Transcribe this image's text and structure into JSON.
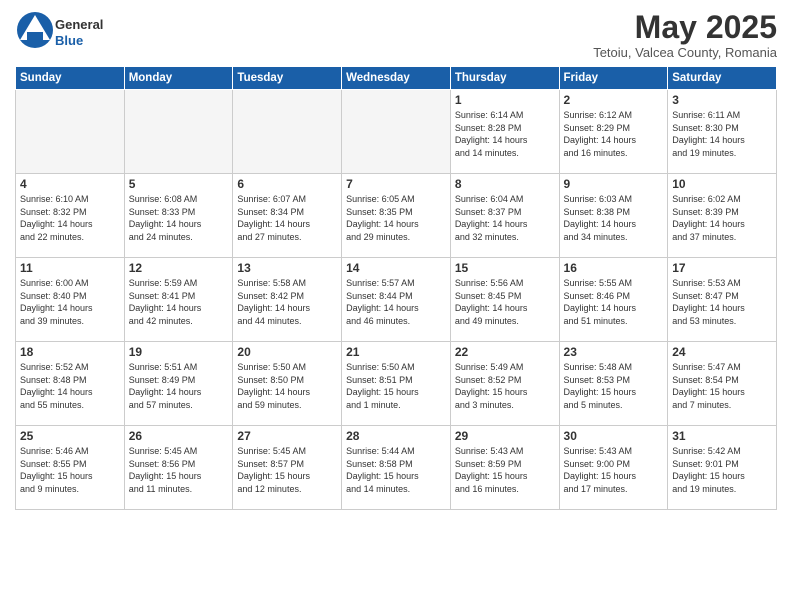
{
  "logo": {
    "general": "General",
    "blue": "Blue"
  },
  "title": "May 2025",
  "location": "Tetoiu, Valcea County, Romania",
  "headers": [
    "Sunday",
    "Monday",
    "Tuesday",
    "Wednesday",
    "Thursday",
    "Friday",
    "Saturday"
  ],
  "weeks": [
    [
      {
        "day": "",
        "info": ""
      },
      {
        "day": "",
        "info": ""
      },
      {
        "day": "",
        "info": ""
      },
      {
        "day": "",
        "info": ""
      },
      {
        "day": "1",
        "info": "Sunrise: 6:14 AM\nSunset: 8:28 PM\nDaylight: 14 hours\nand 14 minutes."
      },
      {
        "day": "2",
        "info": "Sunrise: 6:12 AM\nSunset: 8:29 PM\nDaylight: 14 hours\nand 16 minutes."
      },
      {
        "day": "3",
        "info": "Sunrise: 6:11 AM\nSunset: 8:30 PM\nDaylight: 14 hours\nand 19 minutes."
      }
    ],
    [
      {
        "day": "4",
        "info": "Sunrise: 6:10 AM\nSunset: 8:32 PM\nDaylight: 14 hours\nand 22 minutes."
      },
      {
        "day": "5",
        "info": "Sunrise: 6:08 AM\nSunset: 8:33 PM\nDaylight: 14 hours\nand 24 minutes."
      },
      {
        "day": "6",
        "info": "Sunrise: 6:07 AM\nSunset: 8:34 PM\nDaylight: 14 hours\nand 27 minutes."
      },
      {
        "day": "7",
        "info": "Sunrise: 6:05 AM\nSunset: 8:35 PM\nDaylight: 14 hours\nand 29 minutes."
      },
      {
        "day": "8",
        "info": "Sunrise: 6:04 AM\nSunset: 8:37 PM\nDaylight: 14 hours\nand 32 minutes."
      },
      {
        "day": "9",
        "info": "Sunrise: 6:03 AM\nSunset: 8:38 PM\nDaylight: 14 hours\nand 34 minutes."
      },
      {
        "day": "10",
        "info": "Sunrise: 6:02 AM\nSunset: 8:39 PM\nDaylight: 14 hours\nand 37 minutes."
      }
    ],
    [
      {
        "day": "11",
        "info": "Sunrise: 6:00 AM\nSunset: 8:40 PM\nDaylight: 14 hours\nand 39 minutes."
      },
      {
        "day": "12",
        "info": "Sunrise: 5:59 AM\nSunset: 8:41 PM\nDaylight: 14 hours\nand 42 minutes."
      },
      {
        "day": "13",
        "info": "Sunrise: 5:58 AM\nSunset: 8:42 PM\nDaylight: 14 hours\nand 44 minutes."
      },
      {
        "day": "14",
        "info": "Sunrise: 5:57 AM\nSunset: 8:44 PM\nDaylight: 14 hours\nand 46 minutes."
      },
      {
        "day": "15",
        "info": "Sunrise: 5:56 AM\nSunset: 8:45 PM\nDaylight: 14 hours\nand 49 minutes."
      },
      {
        "day": "16",
        "info": "Sunrise: 5:55 AM\nSunset: 8:46 PM\nDaylight: 14 hours\nand 51 minutes."
      },
      {
        "day": "17",
        "info": "Sunrise: 5:53 AM\nSunset: 8:47 PM\nDaylight: 14 hours\nand 53 minutes."
      }
    ],
    [
      {
        "day": "18",
        "info": "Sunrise: 5:52 AM\nSunset: 8:48 PM\nDaylight: 14 hours\nand 55 minutes."
      },
      {
        "day": "19",
        "info": "Sunrise: 5:51 AM\nSunset: 8:49 PM\nDaylight: 14 hours\nand 57 minutes."
      },
      {
        "day": "20",
        "info": "Sunrise: 5:50 AM\nSunset: 8:50 PM\nDaylight: 14 hours\nand 59 minutes."
      },
      {
        "day": "21",
        "info": "Sunrise: 5:50 AM\nSunset: 8:51 PM\nDaylight: 15 hours\nand 1 minute."
      },
      {
        "day": "22",
        "info": "Sunrise: 5:49 AM\nSunset: 8:52 PM\nDaylight: 15 hours\nand 3 minutes."
      },
      {
        "day": "23",
        "info": "Sunrise: 5:48 AM\nSunset: 8:53 PM\nDaylight: 15 hours\nand 5 minutes."
      },
      {
        "day": "24",
        "info": "Sunrise: 5:47 AM\nSunset: 8:54 PM\nDaylight: 15 hours\nand 7 minutes."
      }
    ],
    [
      {
        "day": "25",
        "info": "Sunrise: 5:46 AM\nSunset: 8:55 PM\nDaylight: 15 hours\nand 9 minutes."
      },
      {
        "day": "26",
        "info": "Sunrise: 5:45 AM\nSunset: 8:56 PM\nDaylight: 15 hours\nand 11 minutes."
      },
      {
        "day": "27",
        "info": "Sunrise: 5:45 AM\nSunset: 8:57 PM\nDaylight: 15 hours\nand 12 minutes."
      },
      {
        "day": "28",
        "info": "Sunrise: 5:44 AM\nSunset: 8:58 PM\nDaylight: 15 hours\nand 14 minutes."
      },
      {
        "day": "29",
        "info": "Sunrise: 5:43 AM\nSunset: 8:59 PM\nDaylight: 15 hours\nand 16 minutes."
      },
      {
        "day": "30",
        "info": "Sunrise: 5:43 AM\nSunset: 9:00 PM\nDaylight: 15 hours\nand 17 minutes."
      },
      {
        "day": "31",
        "info": "Sunrise: 5:42 AM\nSunset: 9:01 PM\nDaylight: 15 hours\nand 19 minutes."
      }
    ]
  ]
}
